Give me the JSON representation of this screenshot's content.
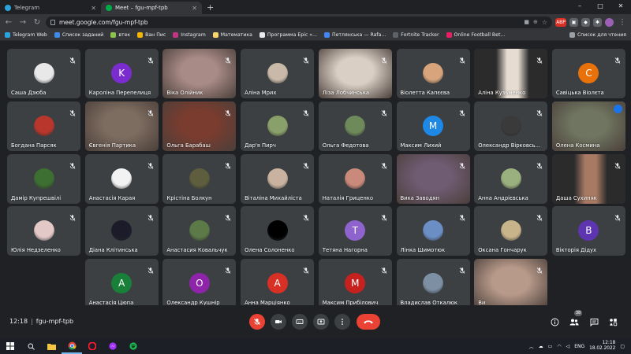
{
  "browser": {
    "tabs": [
      {
        "label": "Telegram",
        "active": false
      },
      {
        "label": "Meet – fgu-mpf-tpb",
        "active": true
      }
    ],
    "url": "meet.google.com/fgu-mpf-tpb",
    "bookmarks": [
      "Telegram Web",
      "Список заданий",
      "втек",
      "Ван Пис",
      "Instagram",
      "Математика",
      "Программа Epic «...",
      "Петлянська — Rafa...",
      "Fortnite Tracker",
      "Online Football Bet..."
    ],
    "reading_list": "Список для чтения",
    "ext_badge": "ABP",
    "win_controls": [
      "–",
      "□",
      "✕"
    ]
  },
  "participants": [
    {
      "name": "Саша Дзюба",
      "avatar": "photo",
      "color": "#e8e8e8"
    },
    {
      "name": "Кароліна Перепелиця",
      "avatar": "letter",
      "letter": "K",
      "color": "#7b2ccf"
    },
    {
      "name": "Віка Олiйник",
      "avatar": "video",
      "color": "#a88a86"
    },
    {
      "name": "Аліна Мрих",
      "avatar": "photo",
      "color": "#c9b9a8"
    },
    {
      "name": "Ліза Лобчинська",
      "avatar": "video",
      "color": "#d9cfc4"
    },
    {
      "name": "Віолетта Капєєва",
      "avatar": "photo",
      "color": "#d7a47c"
    },
    {
      "name": "Аліна Кузьменко",
      "avatar": "video-dark",
      "color": "#e7dcd2"
    },
    {
      "name": "Савіцька Віолєта",
      "avatar": "letter",
      "letter": "С",
      "color": "#e8710a"
    },
    {
      "name": "Богдана Парсяк",
      "avatar": "photo",
      "color": "#b8362b"
    },
    {
      "name": "Євгенія Партика",
      "avatar": "video",
      "color": "#7d6c60"
    },
    {
      "name": "Ольга Барабаш",
      "avatar": "video",
      "color": "#7a3c2f"
    },
    {
      "name": "Дар'я Пирч",
      "avatar": "photo",
      "color": "#8aa06a"
    },
    {
      "name": "Ольга Федотова",
      "avatar": "photo",
      "color": "#6e8a5b"
    },
    {
      "name": "Максим Лихий",
      "avatar": "letter",
      "letter": "M",
      "color": "#1e88e5"
    },
    {
      "name": "Олександр Вірковсь...",
      "avatar": "photo",
      "color": "#3a3a3a"
    },
    {
      "name": "Олена Космина",
      "avatar": "video",
      "color": "#6f7560"
    },
    {
      "name": "Дамір Купрешвілі",
      "avatar": "photo",
      "color": "#3d6e32"
    },
    {
      "name": "Анастасія Карая",
      "avatar": "photo",
      "color": "#f2f2f2"
    },
    {
      "name": "Крістіна Болкун",
      "avatar": "photo",
      "color": "#5e5e3f"
    },
    {
      "name": "Віталіна Михайлiста",
      "avatar": "photo",
      "color": "#c9b3a0"
    },
    {
      "name": "Наталія Гриценко",
      "avatar": "photo",
      "color": "#c9897b"
    },
    {
      "name": "Вика Заводян",
      "avatar": "video",
      "color": "#6f5b72"
    },
    {
      "name": "Анна Андрієвська",
      "avatar": "photo",
      "color": "#9bb07f"
    },
    {
      "name": "Даша Сухиняк",
      "avatar": "video-dark",
      "color": "#a87a63"
    },
    {
      "name": "Юлія Недзеленко",
      "avatar": "photo",
      "color": "#e3c8c8"
    },
    {
      "name": "Діана Клітинська",
      "avatar": "photo",
      "color": "#1b1b2a"
    },
    {
      "name": "Анастасия Ковальчук",
      "avatar": "photo",
      "color": "#5b7a47"
    },
    {
      "name": "Олена Солоненко",
      "avatar": "photo",
      "color": "#000000"
    },
    {
      "name": "Тетяна Нагорна",
      "avatar": "letter",
      "letter": "T",
      "color": "#8e63ce"
    },
    {
      "name": "Лінка Шимотюк",
      "avatar": "photo",
      "color": "#6b8ec5"
    },
    {
      "name": "Оксана Гончарук",
      "avatar": "photo",
      "color": "#c7b48a"
    },
    {
      "name": "Вікторія Дідух",
      "avatar": "letter",
      "letter": "B",
      "color": "#5e35b1"
    },
    {
      "name": "Анастасія Цюпа",
      "avatar": "letter",
      "letter": "A",
      "color": "#188038"
    },
    {
      "name": "Олександр Кушнір",
      "avatar": "letter",
      "letter": "O",
      "color": "#8e24aa"
    },
    {
      "name": "Анна Марціянко",
      "avatar": "letter",
      "letter": "A",
      "color": "#d93025"
    },
    {
      "name": "Максим Прибілович",
      "avatar": "letter",
      "letter": "M",
      "color": "#c5221f"
    },
    {
      "name": "Владислав Откалюк",
      "avatar": "photo",
      "color": "#7c8fa3"
    },
    {
      "name": "Ви",
      "avatar": "video",
      "color": "#b89a8a"
    }
  ],
  "speaking_index": 15,
  "meeting": {
    "time": "12:18",
    "code": "fgu-mpf-tpb",
    "participant_count": "38"
  },
  "taskbar": {
    "lang": "ENG",
    "time": "12:18",
    "date": "18.02.2022"
  }
}
